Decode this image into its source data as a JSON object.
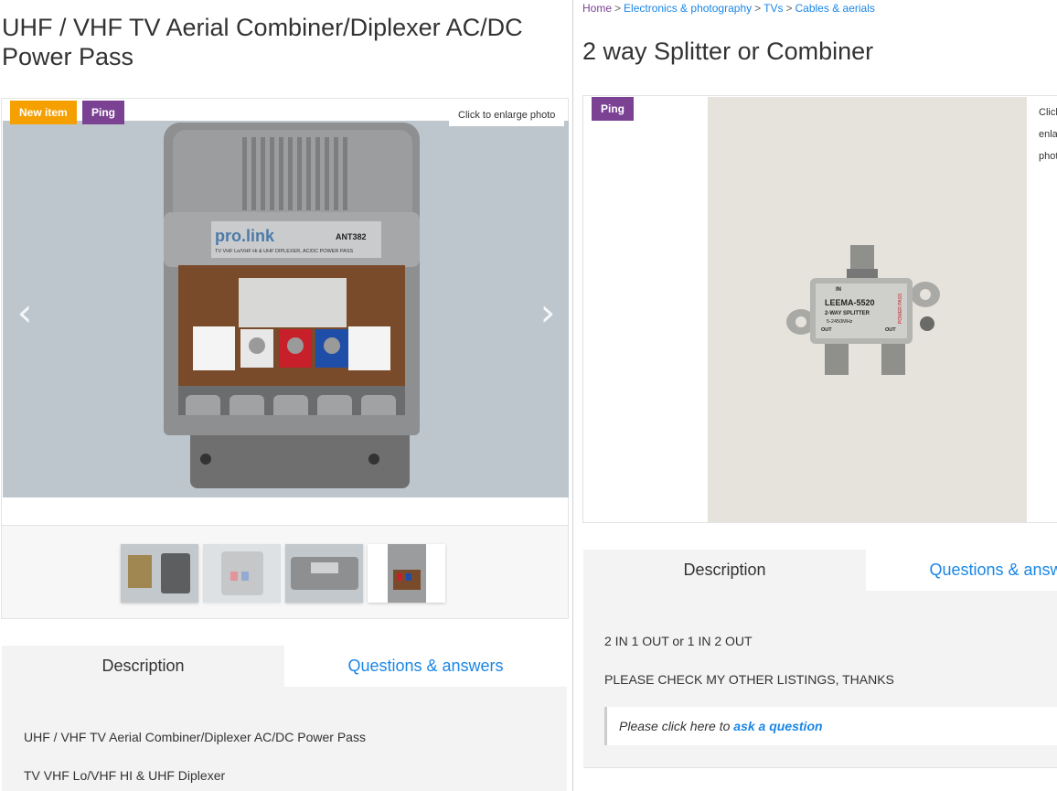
{
  "left": {
    "title": "UHF / VHF TV Aerial Combiner/Diplexer AC/DC Power Pass",
    "badges": {
      "new": "New item",
      "ping": "Ping"
    },
    "enlarge": "Click to enlarge photo",
    "photo": {
      "brand": "pro.link",
      "model": "ANT382",
      "subtitle": "TV VHF Lo/VHF Hi & UHF DIPLEXER, AC/DC POWER PASS"
    },
    "tabs": {
      "description": "Description",
      "qa": "Questions & answers"
    },
    "description": [
      "UHF / VHF TV Aerial Combiner/Diplexer AC/DC Power Pass",
      "TV VHF Lo/VHF HI & UHF Diplexer"
    ]
  },
  "right": {
    "breadcrumb": [
      "Home",
      "Electronics & photography",
      "TVs",
      "Cables & aerials"
    ],
    "breadcrumb_sep": ">",
    "title": "2 way Splitter or Combiner",
    "badge_ping": "Ping",
    "enlarge": "Click to enlarge photo",
    "photo": {
      "model": "LEEMA-5520",
      "type": "2-WAY SPLITTER",
      "freq": "5-2450MHz",
      "in": "IN",
      "out": "OUT",
      "pass": "POWER PASS"
    },
    "tabs": {
      "description": "Description",
      "qa": "Questions & answers"
    },
    "description": [
      "2 IN 1 OUT or 1 IN 2 OUT",
      "PLEASE CHECK MY OTHER LISTINGS, THANKS"
    ],
    "ask": {
      "prefix": "Please click here to ",
      "link": "ask a question"
    }
  }
}
